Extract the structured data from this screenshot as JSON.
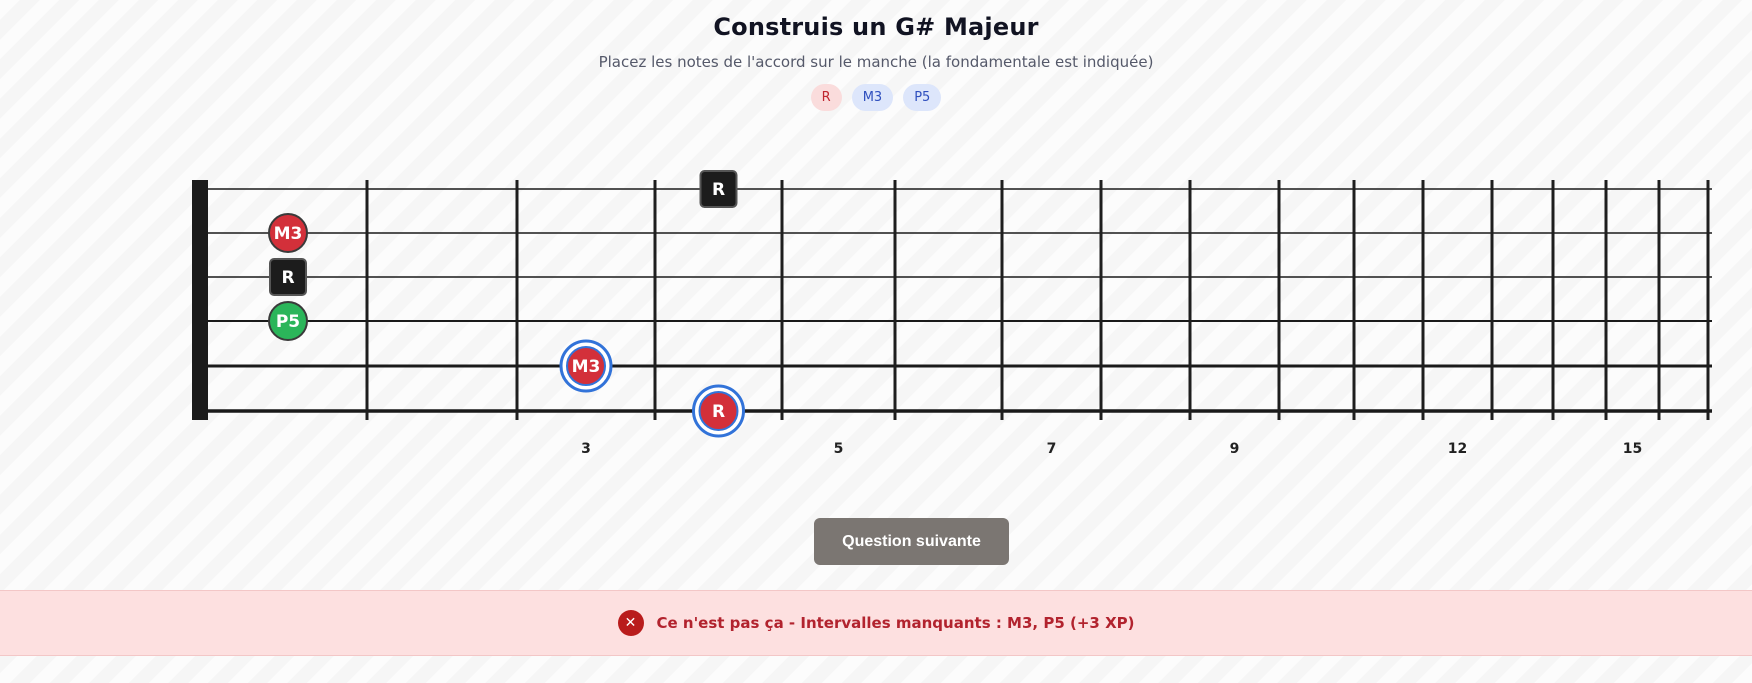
{
  "header": {
    "title": "Construis un G# Majeur",
    "subtitle": "Placez les notes de l'accord sur le manche (la fondamentale est indiquée)"
  },
  "legend": [
    {
      "label": "R",
      "kind": "root"
    },
    {
      "label": "M3",
      "kind": "interval"
    },
    {
      "label": "P5",
      "kind": "interval"
    }
  ],
  "fretboard": {
    "string_count": 6,
    "fret_count": 16,
    "fret_numbers": [
      3,
      5,
      7,
      9,
      12,
      15
    ],
    "markers": [
      {
        "label": "M3",
        "string": 2,
        "fret": 0,
        "style": "red",
        "interactable": false
      },
      {
        "label": "R",
        "string": 3,
        "fret": 0,
        "style": "dark",
        "interactable": false
      },
      {
        "label": "P5",
        "string": 4,
        "fret": 0,
        "style": "green",
        "interactable": false
      },
      {
        "label": "R",
        "string": 1,
        "fret": 4,
        "style": "dark",
        "interactable": false
      },
      {
        "label": "M3",
        "string": 5,
        "fret": 3,
        "style": "selected",
        "interactable": true
      },
      {
        "label": "R",
        "string": 6,
        "fret": 4,
        "style": "selected",
        "interactable": true
      }
    ]
  },
  "actions": {
    "next_label": "Question suivante"
  },
  "feedback": {
    "icon": "close-icon",
    "text": "Ce n'est pas ça - Intervalles manquants : M3, P5 (+3 XP)"
  },
  "colors": {
    "red": "#d3303a",
    "green": "#2bb55a",
    "dark": "#1c1c1c",
    "selected_ring": "#3273d9",
    "feedback_bg": "#fde0e0"
  }
}
